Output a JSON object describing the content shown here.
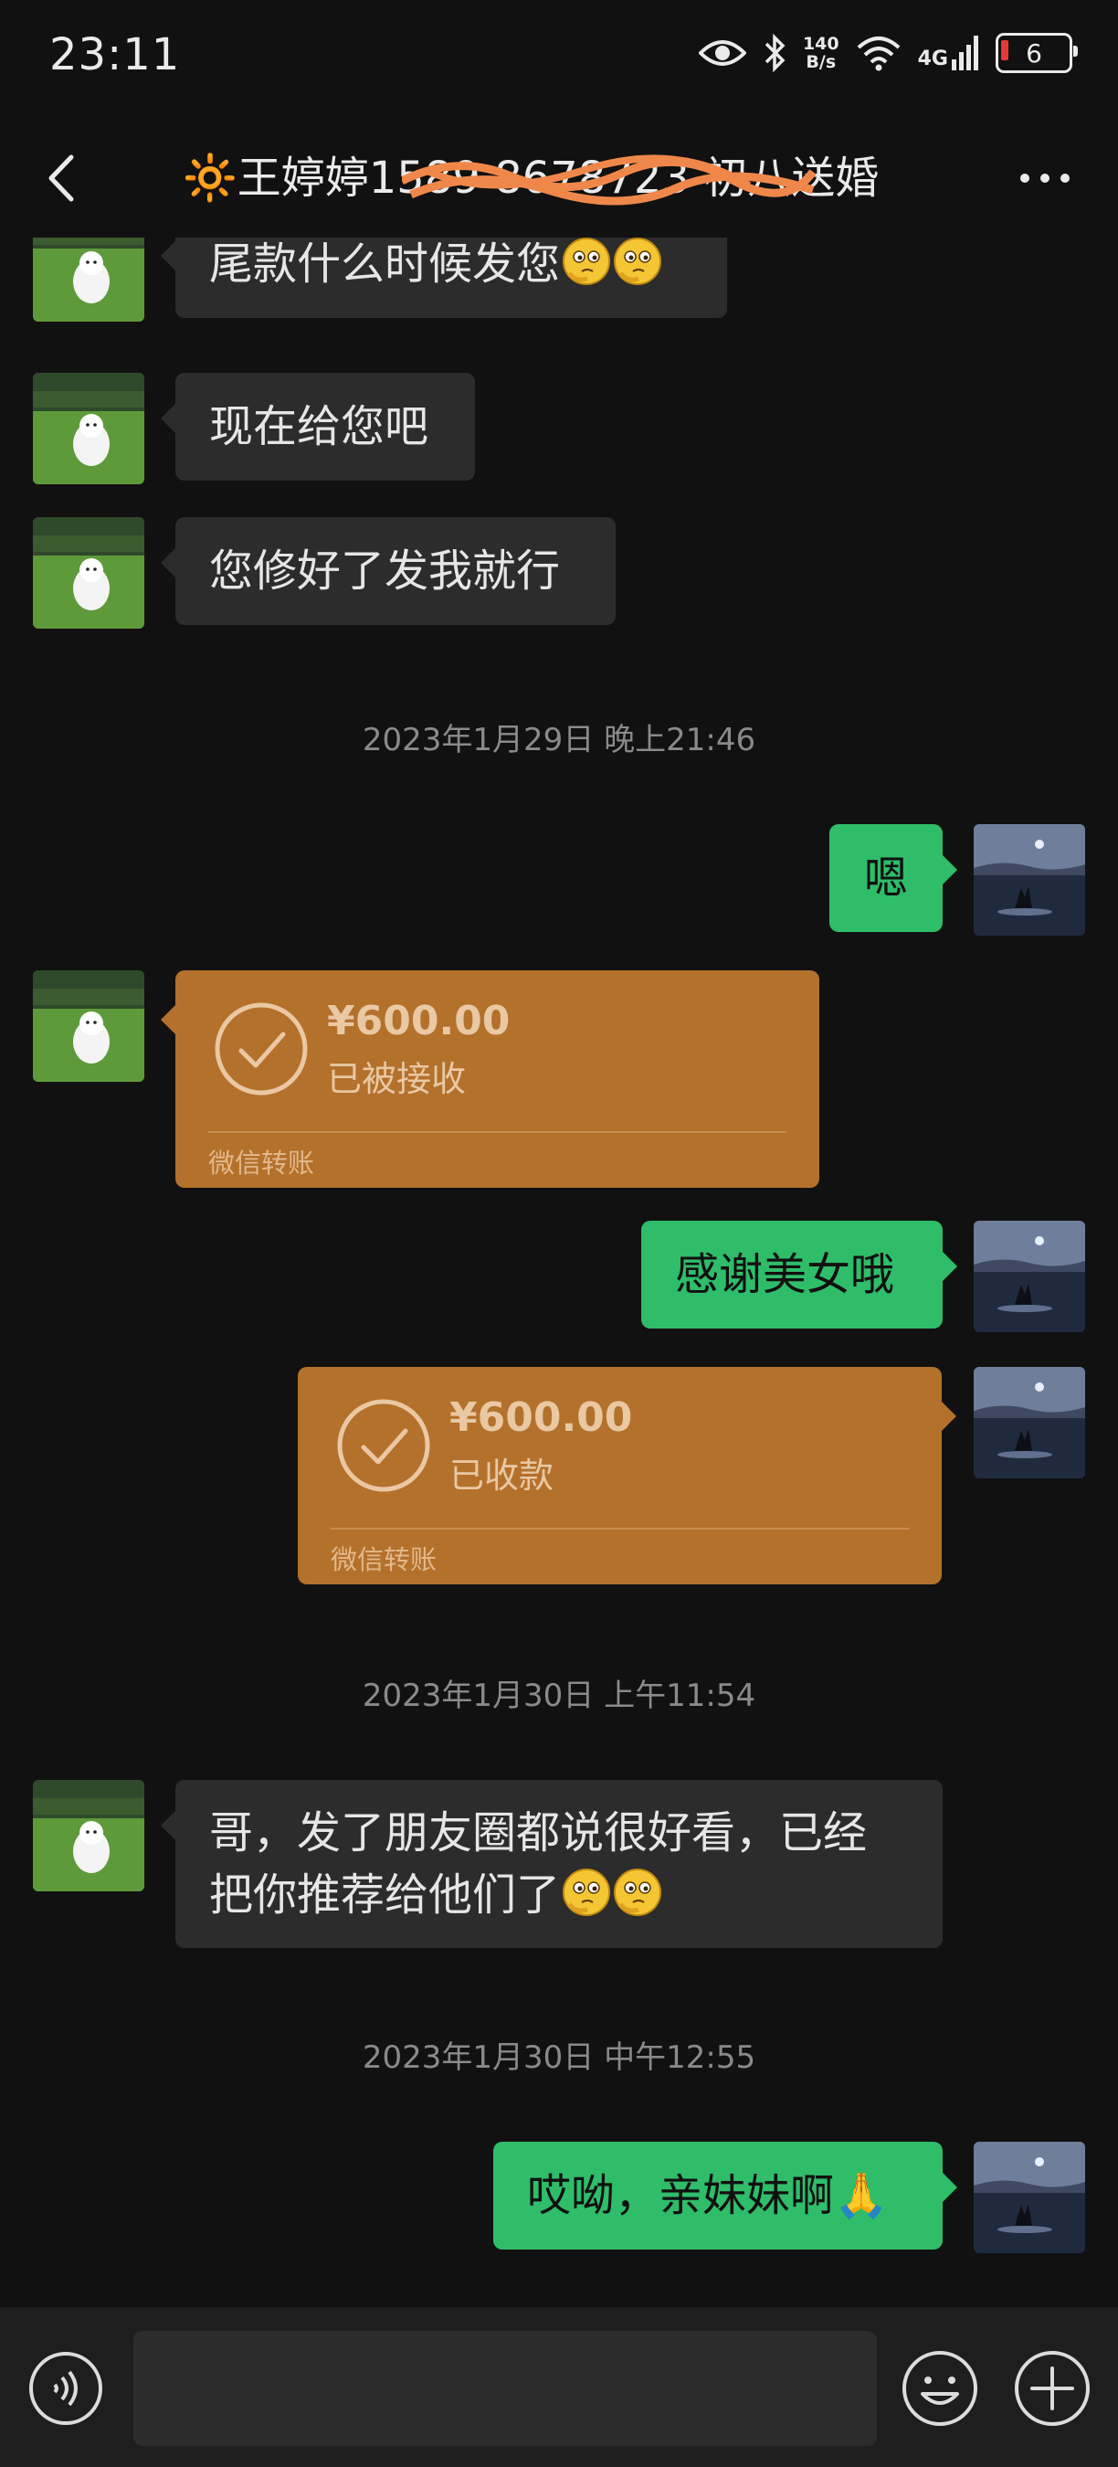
{
  "status_bar": {
    "time": "23:11",
    "speed_value": "140",
    "speed_unit": "B/s",
    "network": "4G",
    "battery": "6"
  },
  "header": {
    "title_prefix": "🔆",
    "title": "王婷婷1589 8678723 初八送婚",
    "back_icon": "chevron-left-icon",
    "more_icon": "more-dots-icon"
  },
  "messages": [
    {
      "side": "in",
      "text": "尾款什么时候发您",
      "emoji": [
        "thinking-face-emoji",
        "thinking-face-emoji"
      ]
    },
    {
      "side": "in",
      "text": "现在给您吧"
    },
    {
      "side": "in",
      "text": "您修好了发我就行"
    },
    {
      "type": "timestamp",
      "text": "2023年1月29日 晚上21:46"
    },
    {
      "side": "out",
      "text": "嗯"
    },
    {
      "side": "in",
      "type": "transfer",
      "amount": "¥600.00",
      "status": "已被接收",
      "source": "微信转账"
    },
    {
      "side": "out",
      "text": "感谢美女哦"
    },
    {
      "side": "out",
      "type": "transfer",
      "amount": "¥600.00",
      "status": "已收款",
      "source": "微信转账"
    },
    {
      "type": "timestamp",
      "text": "2023年1月30日 上午11:54"
    },
    {
      "side": "in",
      "text_line1": "哥，发了朋友圈都说很好看，已经",
      "text_line2": "把你推荐给他们了",
      "emoji": [
        "thinking-face-emoji",
        "thinking-face-emoji"
      ]
    },
    {
      "type": "timestamp",
      "text": "2023年1月30日 中午12:55"
    },
    {
      "side": "out",
      "text": "哎呦，亲妹妹啊🙏"
    }
  ],
  "bottom_bar": {
    "input_placeholder": "",
    "voice_icon": "voice-icon",
    "emoji_icon": "smiley-icon",
    "plus_icon": "plus-icon"
  },
  "colors": {
    "background": "#111111",
    "incoming_bubble": "#2c2c2c",
    "outgoing_bubble": "#2fbd6a",
    "transfer_card": "#b3712c",
    "timestamp_text": "#8a8a8a"
  }
}
